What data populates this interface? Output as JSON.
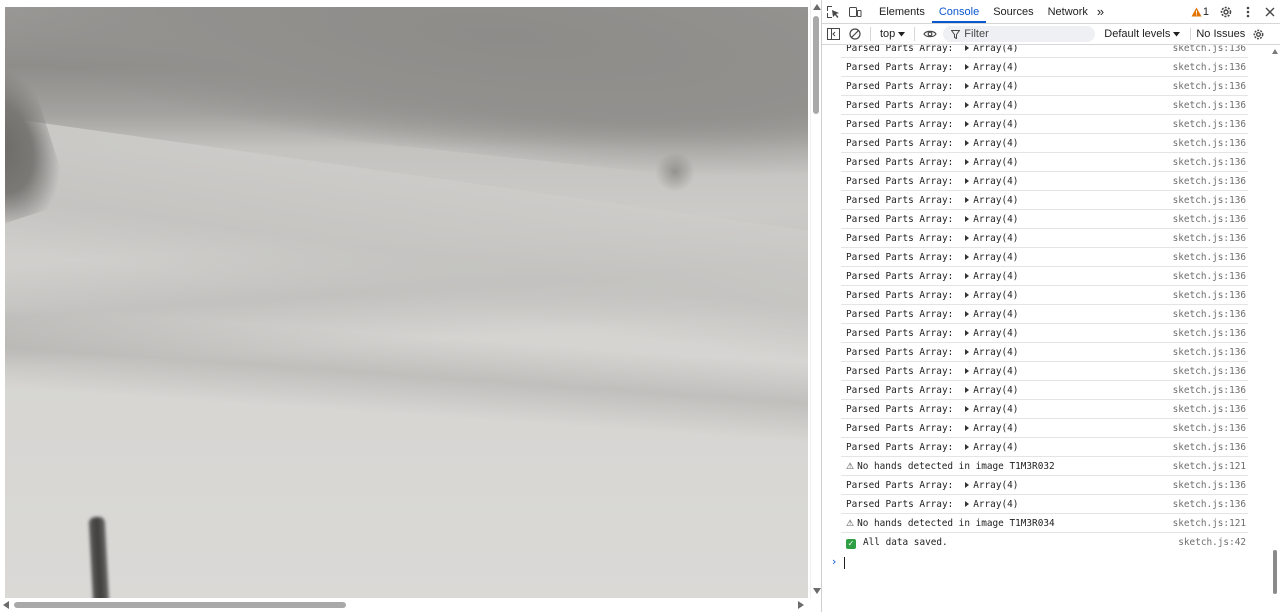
{
  "devtools": {
    "tabs": [
      {
        "label": "Elements"
      },
      {
        "label": "Console"
      },
      {
        "label": "Sources"
      },
      {
        "label": "Network"
      }
    ],
    "more_tabs_label": "»",
    "warning_count": "1",
    "toolbar": {
      "context": "top",
      "filter_placeholder": "Filter",
      "levels": "Default levels",
      "issues": "No Issues"
    },
    "messages": [
      {
        "type": "log",
        "label": "Parsed Parts Array:",
        "value": "Array(4)",
        "source": "sketch.js:136"
      },
      {
        "type": "log",
        "label": "Parsed Parts Array:",
        "value": "Array(4)",
        "source": "sketch.js:136"
      },
      {
        "type": "log",
        "label": "Parsed Parts Array:",
        "value": "Array(4)",
        "source": "sketch.js:136"
      },
      {
        "type": "log",
        "label": "Parsed Parts Array:",
        "value": "Array(4)",
        "source": "sketch.js:136"
      },
      {
        "type": "log",
        "label": "Parsed Parts Array:",
        "value": "Array(4)",
        "source": "sketch.js:136"
      },
      {
        "type": "log",
        "label": "Parsed Parts Array:",
        "value": "Array(4)",
        "source": "sketch.js:136"
      },
      {
        "type": "log",
        "label": "Parsed Parts Array:",
        "value": "Array(4)",
        "source": "sketch.js:136"
      },
      {
        "type": "log",
        "label": "Parsed Parts Array:",
        "value": "Array(4)",
        "source": "sketch.js:136"
      },
      {
        "type": "log",
        "label": "Parsed Parts Array:",
        "value": "Array(4)",
        "source": "sketch.js:136"
      },
      {
        "type": "log",
        "label": "Parsed Parts Array:",
        "value": "Array(4)",
        "source": "sketch.js:136"
      },
      {
        "type": "log",
        "label": "Parsed Parts Array:",
        "value": "Array(4)",
        "source": "sketch.js:136"
      },
      {
        "type": "log",
        "label": "Parsed Parts Array:",
        "value": "Array(4)",
        "source": "sketch.js:136"
      },
      {
        "type": "log",
        "label": "Parsed Parts Array:",
        "value": "Array(4)",
        "source": "sketch.js:136"
      },
      {
        "type": "log",
        "label": "Parsed Parts Array:",
        "value": "Array(4)",
        "source": "sketch.js:136"
      },
      {
        "type": "log",
        "label": "Parsed Parts Array:",
        "value": "Array(4)",
        "source": "sketch.js:136"
      },
      {
        "type": "log",
        "label": "Parsed Parts Array:",
        "value": "Array(4)",
        "source": "sketch.js:136"
      },
      {
        "type": "log",
        "label": "Parsed Parts Array:",
        "value": "Array(4)",
        "source": "sketch.js:136"
      },
      {
        "type": "log",
        "label": "Parsed Parts Array:",
        "value": "Array(4)",
        "source": "sketch.js:136"
      },
      {
        "type": "log",
        "label": "Parsed Parts Array:",
        "value": "Array(4)",
        "source": "sketch.js:136"
      },
      {
        "type": "log",
        "label": "Parsed Parts Array:",
        "value": "Array(4)",
        "source": "sketch.js:136"
      },
      {
        "type": "log",
        "label": "Parsed Parts Array:",
        "value": "Array(4)",
        "source": "sketch.js:136"
      },
      {
        "type": "log",
        "label": "Parsed Parts Array:",
        "value": "Array(4)",
        "source": "sketch.js:136"
      },
      {
        "type": "warn",
        "label": "No hands detected in image T1M3R032",
        "value": "",
        "source": "sketch.js:121"
      },
      {
        "type": "log",
        "label": "Parsed Parts Array:",
        "value": "Array(4)",
        "source": "sketch.js:136"
      },
      {
        "type": "log",
        "label": "Parsed Parts Array:",
        "value": "Array(4)",
        "source": "sketch.js:136"
      },
      {
        "type": "warn",
        "label": "No hands detected in image T1M3R034",
        "value": "",
        "source": "sketch.js:121"
      },
      {
        "type": "success",
        "label": "All data saved.",
        "value": "",
        "source": "sketch.js:42"
      }
    ],
    "icons": {
      "inspect": "inspect-element-icon",
      "device": "device-toolbar-icon",
      "warning": "warning-icon",
      "settings": "gear-icon",
      "more": "kebab-menu-icon",
      "close": "close-icon",
      "sidebar": "sidebar-toggle-icon",
      "clear": "clear-console-icon",
      "eye": "live-expression-icon",
      "filter": "filter-icon"
    },
    "colors": {
      "accent": "#0b57d0",
      "success": "#2ea043",
      "warning": "#e37400"
    }
  }
}
